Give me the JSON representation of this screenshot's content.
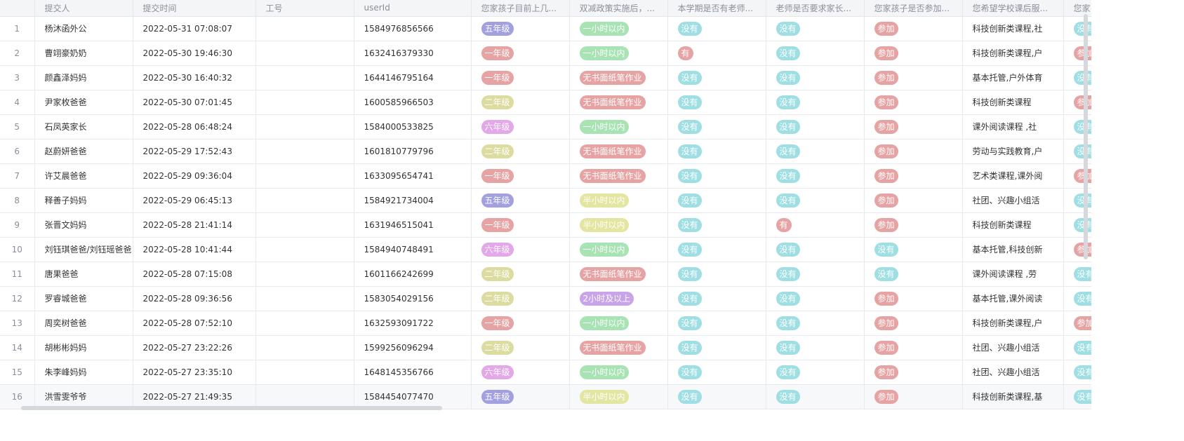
{
  "columns": [
    "",
    "提交人",
    "提交时间",
    "工号",
    "userId",
    "您家孩子目前上几...",
    "双减政策实施后，...",
    "本学期是否有老师...",
    "老师是否要求家长...",
    "您家孩子是否参加...",
    "您希望学校课后服...",
    "您家"
  ],
  "tag_colors": {
    "五年级": "#a3a0e0",
    "一年级": "#e6a3a3",
    "二年级": "#dcdca0",
    "六年级": "#e3a8e8",
    "一小时以内": "#a8e3b3",
    "无书面纸笔作业": "#e6a3a3",
    "半小时以内": "#e3e6a0",
    "2小时及以上": "#c8a4e8",
    "没有": "#9fdfe3",
    "有": "#e6a3a3",
    "参加": "#e6a3a3"
  },
  "rows": [
    {
      "idx": "1",
      "name": "杨沐函外公",
      "time": "2022-05-31 07:08:07",
      "emp": "",
      "uid": "1584976856566",
      "grade": "五年级",
      "hw": "一小时以内",
      "q1": "没有",
      "q2": "没有",
      "q3": "参加",
      "want": "科技创新类课程,社",
      "last": "没有"
    },
    {
      "idx": "2",
      "name": "曹翊豪奶奶",
      "time": "2022-05-30 19:46:30",
      "emp": "",
      "uid": "1632416379330",
      "grade": "一年级",
      "hw": "一小时以内",
      "q1": "有",
      "q2": "没有",
      "q3": "参加",
      "want": "科技创新类课程,户",
      "last": "参加"
    },
    {
      "idx": "3",
      "name": "颜鑫泽妈妈",
      "time": "2022-05-30 16:40:32",
      "emp": "",
      "uid": "1644146795164",
      "grade": "一年级",
      "hw": "无书面纸笔作业",
      "q1": "没有",
      "q2": "没有",
      "q3": "参加",
      "want": "基本托管,户外体育",
      "last": "没有"
    },
    {
      "idx": "4",
      "name": "尹家枚爸爸",
      "time": "2022-05-30 07:01:45",
      "emp": "",
      "uid": "1600585966503",
      "grade": "二年级",
      "hw": "无书面纸笔作业",
      "q1": "没有",
      "q2": "没有",
      "q3": "参加",
      "want": "科技创新类课程",
      "last": "参加"
    },
    {
      "idx": "5",
      "name": "石凤英家长",
      "time": "2022-05-28 06:48:24",
      "emp": "",
      "uid": "1584000533825",
      "grade": "六年级",
      "hw": "一小时以内",
      "q1": "没有",
      "q2": "没有",
      "q3": "参加",
      "want": "课外阅读课程 ,社",
      "last": "没有"
    },
    {
      "idx": "6",
      "name": "赵蔚妍爸爸",
      "time": "2022-05-29 17:52:43",
      "emp": "",
      "uid": "1601810779796",
      "grade": "二年级",
      "hw": "无书面纸笔作业",
      "q1": "没有",
      "q2": "没有",
      "q3": "参加",
      "want": "劳动与实践教育,户",
      "last": "没有"
    },
    {
      "idx": "7",
      "name": "许艾晨爸爸",
      "time": "2022-05-29 09:36:04",
      "emp": "",
      "uid": "1633095654741",
      "grade": "一年级",
      "hw": "无书面纸笔作业",
      "q1": "没有",
      "q2": "没有",
      "q3": "参加",
      "want": "艺术类课程,课外阅",
      "last": "参加"
    },
    {
      "idx": "8",
      "name": "释善子妈妈",
      "time": "2022-05-29 06:45:13",
      "emp": "",
      "uid": "1584921734004",
      "grade": "五年级",
      "hw": "半小时以内",
      "q1": "没有",
      "q2": "没有",
      "q3": "参加",
      "want": "社团、兴趣小组活",
      "last": "没有"
    },
    {
      "idx": "9",
      "name": "张晋文妈妈",
      "time": "2022-05-28 21:41:14",
      "emp": "",
      "uid": "1631946515041",
      "grade": "一年级",
      "hw": "半小时以内",
      "q1": "没有",
      "q2": "有",
      "q3": "参加",
      "want": "科技创新类课程",
      "last": "没有"
    },
    {
      "idx": "10",
      "name": "刘钰琪爸爸/刘钰瑶爸爸",
      "time": "2022-05-28 10:41:44",
      "emp": "",
      "uid": "1584940748491",
      "grade": "六年级",
      "hw": "一小时以内",
      "q1": "没有",
      "q2": "没有",
      "q3": "没有",
      "want": "基本托管,科技创新",
      "last": "参加"
    },
    {
      "idx": "11",
      "name": "唐果爸爸",
      "time": "2022-05-28 07:15:08",
      "emp": "",
      "uid": "1601166242699",
      "grade": "二年级",
      "hw": "无书面纸笔作业",
      "q1": "没有",
      "q2": "没有",
      "q3": "没有",
      "want": "课外阅读课程 ,劳",
      "last": "没有"
    },
    {
      "idx": "12",
      "name": "罗睿城爸爸",
      "time": "2022-05-28 09:36:56",
      "emp": "",
      "uid": "1583054029156",
      "grade": "二年级",
      "hw": "2小时及以上",
      "q1": "没有",
      "q2": "没有",
      "q3": "参加",
      "want": "基本托管,课外阅读",
      "last": "没有"
    },
    {
      "idx": "13",
      "name": "周奕树爸爸",
      "time": "2022-05-28 07:52:10",
      "emp": "",
      "uid": "1632593091722",
      "grade": "一年级",
      "hw": "一小时以内",
      "q1": "没有",
      "q2": "没有",
      "q3": "参加",
      "want": "科技创新类课程,户",
      "last": "参加"
    },
    {
      "idx": "14",
      "name": "胡彬彬妈妈",
      "time": "2022-05-27 23:22:26",
      "emp": "",
      "uid": "1599256096294",
      "grade": "二年级",
      "hw": "无书面纸笔作业",
      "q1": "没有",
      "q2": "没有",
      "q3": "参加",
      "want": "社团、兴趣小组活",
      "last": "没有"
    },
    {
      "idx": "15",
      "name": "朱李峰妈妈",
      "time": "2022-05-27 23:35:10",
      "emp": "",
      "uid": "1648145356766",
      "grade": "六年级",
      "hw": "一小时以内",
      "q1": "没有",
      "q2": "没有",
      "q3": "参加",
      "want": "社团、兴趣小组活",
      "last": "没有"
    },
    {
      "idx": "16",
      "name": "洪雪雯爷爷",
      "time": "2022-05-27 21:49:35",
      "emp": "",
      "uid": "1584454077470",
      "grade": "五年级",
      "hw": "半小时以内",
      "q1": "没有",
      "q2": "没有",
      "q3": "参加",
      "want": "科技创新类课程,基",
      "last": "没有"
    }
  ]
}
